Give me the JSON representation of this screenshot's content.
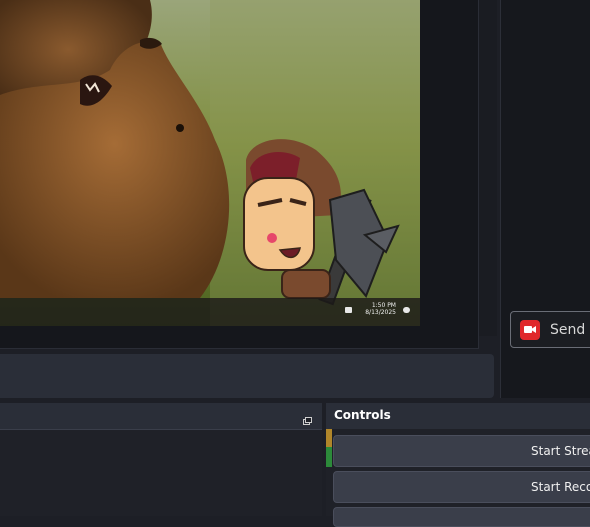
{
  "preview": {
    "clock_time": "1:50 PM",
    "clock_date": "8/13/2025"
  },
  "chat": {
    "send_button_label": "Send a"
  },
  "controls": {
    "title": "Controls",
    "start_streaming_label": "Start Strea",
    "start_recording_label": "Start Reco"
  },
  "colors": {
    "accent_red": "#e0282b",
    "meter_yellow": "#b0862a",
    "meter_green": "#2c8a3a",
    "panel_bg": "#1d1f26"
  },
  "icons": {
    "send": "video-camera-icon",
    "dock_float": "undock-icon"
  }
}
